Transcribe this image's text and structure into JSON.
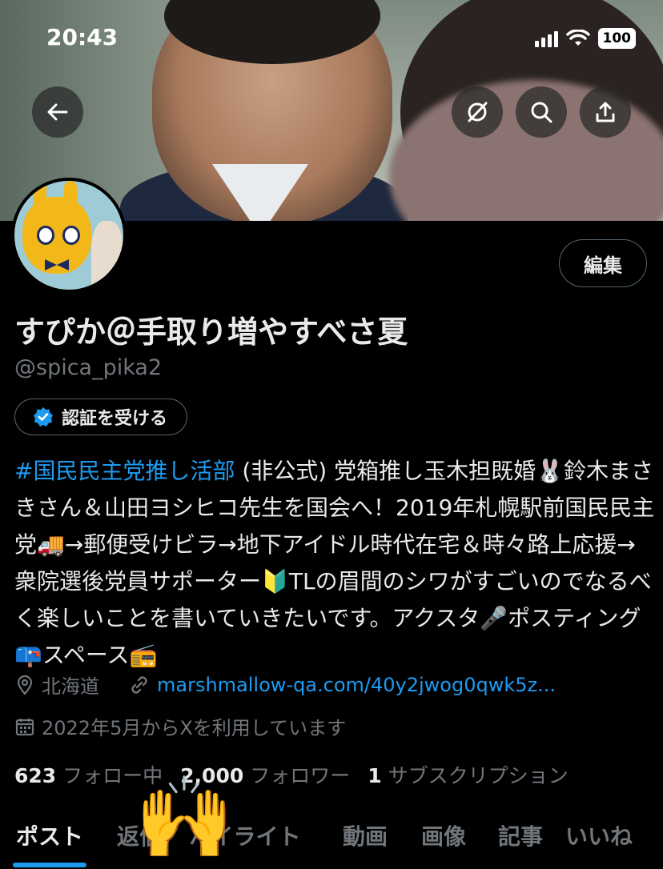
{
  "status_bar": {
    "time": "20:43",
    "battery": "100"
  },
  "header_buttons": {
    "back": "back",
    "grok": "grok",
    "search": "search",
    "share": "share"
  },
  "profile": {
    "edit_label": "編集",
    "name": "すぴか＠手取り増やすべさ夏",
    "handle": "@spica_pika2",
    "verify_label": "認証を受ける",
    "bio_hashtag": "#国民民主党推し活部",
    "bio_text": " (非公式) 党箱推し玉木担既婚🐰鈴木まさきさん＆山田ヨシヒコ先生を国会へ！2019年札幌駅前国民民主党🚚→郵便受けビラ→地下アイドル時代在宅＆時々路上応援→衆院選後党員サポーター🔰TLの眉間のシワがすごいのでなるべく楽しいことを書いていきたいです。アクスタ🎤ポスティング📪スペース📻",
    "location": "北海道",
    "link": "marshmallow-qa.com/40y2jwog0qwk5z...",
    "joined": "2022年5月からXを利用しています",
    "following_count": "623",
    "following_label": "フォロー中",
    "followers_count": "2,000",
    "followers_label": "フォロワー",
    "subscriptions_count": "1",
    "subscriptions_label": "サブスクリプション"
  },
  "tabs": [
    {
      "label": "ポスト",
      "active": true
    },
    {
      "label": "返信"
    },
    {
      "label": "ハイライト"
    },
    {
      "label": "動画"
    },
    {
      "label": "画像"
    },
    {
      "label": "記事"
    },
    {
      "label": "いいね"
    }
  ],
  "overlay_emoji": "🙌",
  "colors": {
    "accent": "#1d9bf0",
    "muted": "#71767b",
    "text": "#e7e9ea",
    "background": "#000000"
  }
}
